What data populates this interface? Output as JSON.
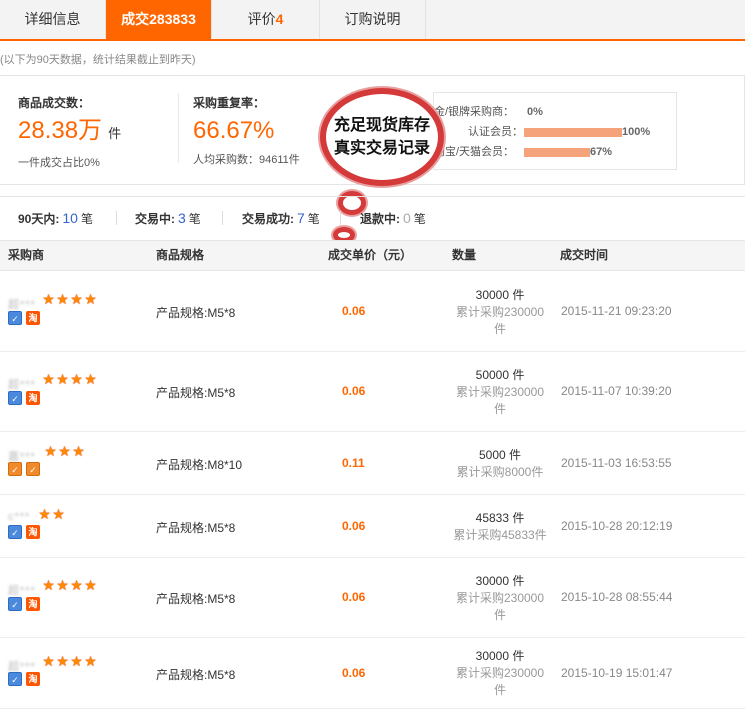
{
  "tabs": [
    {
      "label": "详细信息",
      "num": ""
    },
    {
      "label": "成交",
      "num": "283833"
    },
    {
      "label": "评价",
      "num": "4"
    },
    {
      "label": "订购说明",
      "num": ""
    }
  ],
  "note": "(以下为90天数据，统计结果截止到昨天)",
  "summary": {
    "deals_label": "商品成交数：",
    "deals_value": "28.38万",
    "deals_unit": "件",
    "deals_sub": "一件成交占比0%",
    "repurchase_label": "采购重复率：",
    "repurchase_value": "66.67%",
    "repurchase_sub": "人均采购数：94611件",
    "buyers": [
      {
        "label": "金/银牌采购商：",
        "pct": "0%",
        "bar": 0
      },
      {
        "label": "认证会员：",
        "pct": "100%",
        "bar": 1.0
      },
      {
        "label": "淘宝/天猫会员：",
        "pct": "67%",
        "bar": 0.67
      }
    ]
  },
  "bubble": {
    "line1": "充足现货库存",
    "line2": "真实交易记录"
  },
  "stats": {
    "days_label": "90天内:",
    "days_n": "10",
    "days_unit": "笔",
    "trading_label": "交易中:",
    "trading_n": "3",
    "trading_unit": "笔",
    "success_label": "交易成功:",
    "success_n": "7",
    "success_unit": "笔",
    "refund_label": "退款中:",
    "refund_n": "0",
    "refund_unit": "笔"
  },
  "table": {
    "headers": [
      "采购商",
      "商品规格",
      "成交单价（元）",
      "数量",
      "成交时间"
    ],
    "rows": [
      {
        "buyer": "超***",
        "stars": 4,
        "badges": [
          "cert",
          "tao"
        ],
        "spec": "产品规格:M5*8",
        "price": "0.06",
        "qty": "30000 件",
        "acc1": "累计采购230000",
        "acc2": "件",
        "time": "2015-11-21 09:23:20"
      },
      {
        "buyer": "超***",
        "stars": 4,
        "badges": [
          "cert",
          "tao"
        ],
        "spec": "产品规格:M5*8",
        "price": "0.06",
        "qty": "50000 件",
        "acc1": "累计采购230000",
        "acc2": "件",
        "time": "2015-11-07 10:39:20"
      },
      {
        "buyer": "嘉***",
        "stars": 3,
        "badges": [
          "cert2",
          "cert2"
        ],
        "spec": "产品规格:M8*10",
        "price": "0.11",
        "qty": "5000 件",
        "acc1": "累计采购8000件",
        "acc2": "",
        "time": "2015-11-03 16:53:55"
      },
      {
        "buyer": "c***",
        "stars": 2,
        "badges": [
          "cert",
          "tao"
        ],
        "spec": "产品规格:M5*8",
        "price": "0.06",
        "qty": "45833 件",
        "acc1": "累计采购45833件",
        "acc2": "",
        "time": "2015-10-28 20:12:19"
      },
      {
        "buyer": "超***",
        "stars": 4,
        "badges": [
          "cert",
          "tao"
        ],
        "spec": "产品规格:M5*8",
        "price": "0.06",
        "qty": "30000 件",
        "acc1": "累计采购230000",
        "acc2": "件",
        "time": "2015-10-28 08:55:44"
      },
      {
        "buyer": "超***",
        "stars": 4,
        "badges": [
          "cert",
          "tao"
        ],
        "spec": "产品规格:M5*8",
        "price": "0.06",
        "qty": "30000 件",
        "acc1": "累计采购230000",
        "acc2": "件",
        "time": "2015-10-19 15:01:47"
      }
    ]
  },
  "colors": {
    "accent": "#ff6600",
    "link": "#3366cc",
    "bubble_border": "#d43a3a"
  }
}
